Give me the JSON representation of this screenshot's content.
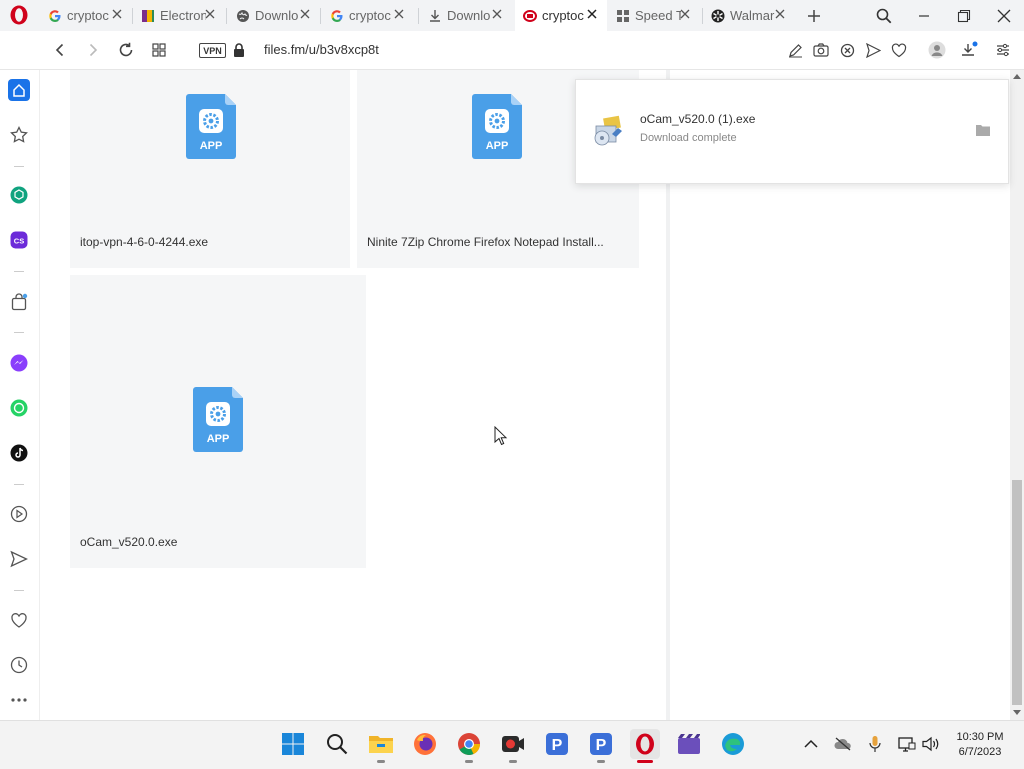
{
  "tabs": [
    {
      "label": "cryptoc",
      "icon": "google-icon"
    },
    {
      "label": "Electron",
      "icon": "electron-favicon-icon"
    },
    {
      "label": "Downlo",
      "icon": "globe-icon"
    },
    {
      "label": "cryptoc",
      "icon": "google-icon"
    },
    {
      "label": "Downlo",
      "icon": "download-icon"
    },
    {
      "label": "cryptoc",
      "icon": "files-fm-icon",
      "active": true
    },
    {
      "label": "Speed T",
      "icon": "grid-icon"
    },
    {
      "label": "Walmar",
      "icon": "walmart-icon"
    }
  ],
  "address": {
    "vpn": "VPN",
    "url": "files.fm/u/b3v8xcp8t"
  },
  "files": [
    {
      "name": "itop-vpn-4-6-0-4244.exe",
      "icon_text": "APP"
    },
    {
      "name": "Ninite 7Zip Chrome Firefox Notepad Install...",
      "icon_text": "APP"
    },
    {
      "name": "oCam_v520.0.exe",
      "icon_text": "APP"
    }
  ],
  "download_popup": {
    "filename": "oCam_v520.0 (1).exe",
    "status": "Download complete"
  },
  "taskbar": {
    "time": "10:30 PM",
    "date": "6/7/2023"
  },
  "colors": {
    "opera_red": "#d0021b",
    "app_icon_blue": "#4a9fe8",
    "sidebar_blue": "#1a73e8"
  }
}
